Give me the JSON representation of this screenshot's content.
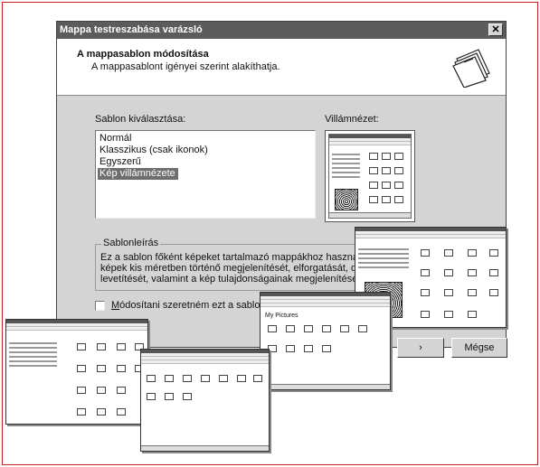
{
  "window": {
    "title": "Mappa testreszabása varázsló",
    "close_glyph": "✕"
  },
  "header": {
    "title": "A mappasablon módosítása",
    "subtitle": "A mappasablont igényei szerint alakíthatja.",
    "icon": "folders-icon"
  },
  "template_section": {
    "label": "Sablon kiválasztása:",
    "items": [
      "Normál",
      "Klasszikus (csak ikonok)",
      "Egyszerű",
      "Kép villámnézete"
    ],
    "selected_index": 3
  },
  "preview_section": {
    "label": "Villámnézet:"
  },
  "description": {
    "legend": "Sablonleírás",
    "lines": [
      "Ez a sablon főként képeket tartalmazó mappákhoz használható. L",
      "képek kis méretben történő megjelenítését, elforgatását, diasoroza",
      "levetítését, valamint a kép tulajdonságainak megjelenítését."
    ]
  },
  "checkbox": {
    "label_underlined": "M",
    "label_rest": "ódosítani szeretném ezt a sablont",
    "checked": false
  },
  "buttons": {
    "next": "›",
    "cancel": "Mégse"
  },
  "thumbnails": {
    "mini_folder_label": "My Pictures"
  },
  "colors": {
    "titlebar": "#5c5c5c",
    "dialog_bg": "#d4d4d4",
    "page_border": "#cc2020",
    "selection": "#6e6e6e"
  }
}
